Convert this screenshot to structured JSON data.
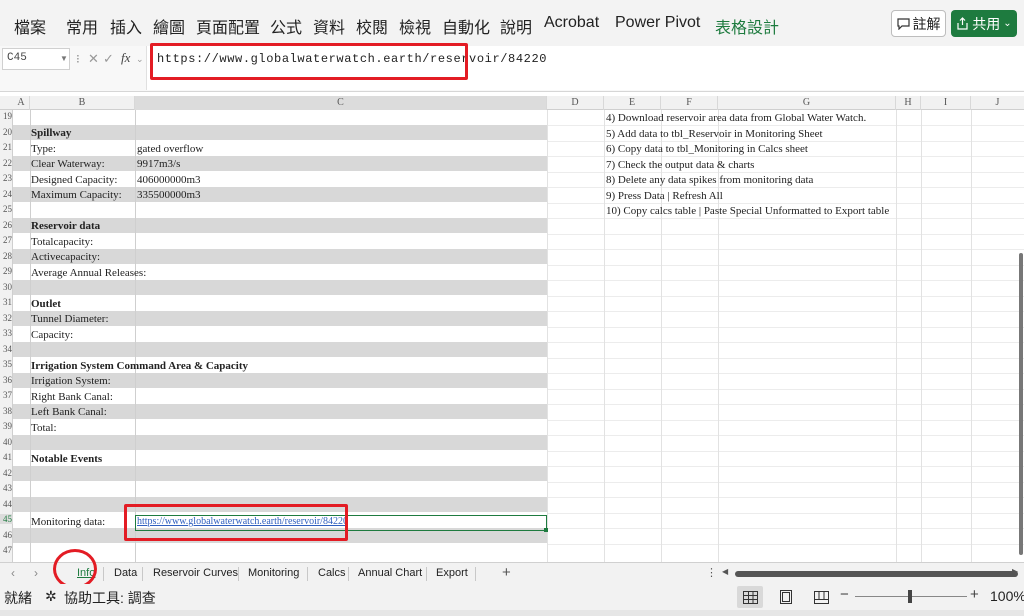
{
  "ribbon": {
    "tabs": [
      "檔案",
      "常用",
      "插入",
      "繪圖",
      "頁面配置",
      "公式",
      "資料",
      "校閱",
      "檢視",
      "自動化",
      "說明",
      "Acrobat",
      "Power Pivot",
      "表格設計"
    ],
    "comment_label": "註解",
    "share_label": "共用"
  },
  "formula_bar": {
    "name_box": "C45",
    "formula": "https://www.globalwaterwatch.earth/reservoir/84220"
  },
  "columns": [
    "A",
    "B",
    "C",
    "D",
    "E",
    "F",
    "G",
    "H",
    "I",
    "J"
  ],
  "rows": [
    "19",
    "20",
    "21",
    "22",
    "23",
    "24",
    "25",
    "26",
    "27",
    "28",
    "29",
    "30",
    "31",
    "32",
    "33",
    "34",
    "35",
    "36",
    "37",
    "38",
    "39",
    "40",
    "41",
    "42",
    "43",
    "44",
    "45",
    "46",
    "47"
  ],
  "sheet": {
    "spillway_heading": "Spillway",
    "type_label": "Type:",
    "type_value": "gated overflow",
    "clear_waterway_label": "Clear Waterway:",
    "clear_waterway_value": "9917m3/s",
    "designed_capacity_label": "Designed Capacity:",
    "designed_capacity_value": "406000000m3",
    "maximum_capacity_label": "Maximum Capacity:",
    "maximum_capacity_value": "335500000m3",
    "reservoir_heading": "Reservoir data",
    "total_capacity_label": "Totalcapacity:",
    "active_capacity_label": "Activecapacity:",
    "annual_releases_label": "Average Annual Releases:",
    "outlet_heading": "Outlet",
    "tunnel_diameter_label": "Tunnel Diameter:",
    "capacity_label": "Capacity:",
    "irrigation_heading": "Irrigation System Command Area & Capacity",
    "irrigation_system_label": "Irrigation System:",
    "right_bank_label": "Right Bank Canal:",
    "left_bank_label": "Left Bank Canal:",
    "total_label": "Total:",
    "notable_events_heading": "Notable Events",
    "monitoring_label": "Monitoring data:",
    "monitoring_link": "https://www.globalwaterwatch.earth/reservoir/84220"
  },
  "instructions": [
    "4) Download reservoir area data from Global Water Watch.",
    "5) Add data to tbl_Reservoir in Monitoring Sheet",
    "6) Copy data to tbl_Monitoring in Calcs sheet",
    "7) Check the output data & charts",
    "8) Delete any data spikes from monitoring data",
    "9) Press Data | Refresh All",
    "10) Copy calcs table | Paste Special Unformatted to Export table"
  ],
  "sheet_tabs": [
    "Info",
    "Data",
    "Reservoir Curves",
    "Monitoring",
    "Calcs",
    "Annual Chart",
    "Export"
  ],
  "status_bar": {
    "ready": "就緒",
    "accessibility": "協助工具: 調查",
    "zoom": "100%"
  },
  "colors": {
    "accent_green": "#1e7b3f",
    "annotation_red": "#e31c24",
    "band_gray": "#d8d8d8",
    "link_blue": "#2f5fbf"
  }
}
